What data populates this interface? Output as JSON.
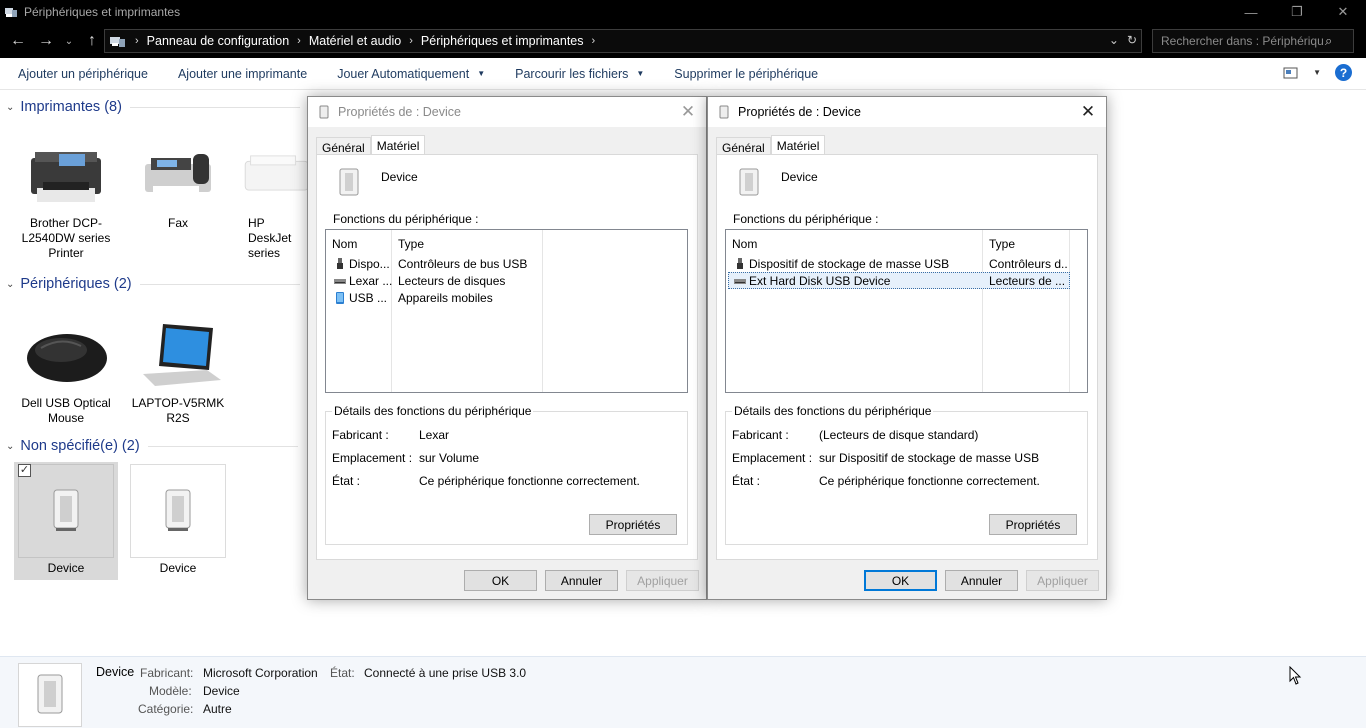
{
  "window": {
    "title": "Périphériques et imprimantes",
    "buttons": [
      "—",
      "❐",
      "✕"
    ]
  },
  "address": {
    "crumbs": [
      "Panneau de configuration",
      "Matériel et audio",
      "Périphériques et imprimantes"
    ],
    "search_placeholder": "Rechercher dans : Périphériqu..."
  },
  "commands": {
    "add_device": "Ajouter un périphérique",
    "add_printer": "Ajouter une imprimante",
    "autoplay": "Jouer Automatiquement",
    "browse_files": "Parcourir les fichiers",
    "remove_device": "Supprimer le périphérique"
  },
  "groups": {
    "printers": "Imprimantes (8)",
    "peripherals": "Périphériques (2)",
    "unspecified": "Non spécifié(e) (2)"
  },
  "devices": {
    "printer1": "Brother DCP-L2540DW series Printer",
    "printer2": "Fax",
    "printer3": "HP DeskJet series",
    "periph1": "Dell USB Optical Mouse",
    "periph2": "LAPTOP-V5RMK R2S",
    "unspec1": "Device",
    "unspec2": "Device"
  },
  "dialog1": {
    "title": "Propriétés de : Device",
    "tab_general": "Général",
    "tab_hardware": "Matériel",
    "device_name": "Device",
    "functions_label": "Fonctions du périphérique :",
    "col_name": "Nom",
    "col_type": "Type",
    "rows": [
      {
        "name": "Dispo...",
        "type": "Contrôleurs de bus USB",
        "icon": "usb-plug-icon"
      },
      {
        "name": "Lexar ...",
        "type": "Lecteurs de disques",
        "icon": "disk-drive-icon"
      },
      {
        "name": "USB ...",
        "type": "Appareils mobiles",
        "icon": "mobile-device-icon"
      }
    ],
    "details_legend": "Détails des fonctions du périphérique",
    "manufacturer_label": "Fabricant :",
    "manufacturer": "Lexar",
    "location_label": "Emplacement :",
    "location": "sur Volume",
    "status_label": "État :",
    "status": "Ce périphérique fonctionne correctement.",
    "properties_btn": "Propriétés",
    "ok": "OK",
    "cancel": "Annuler",
    "apply": "Appliquer"
  },
  "dialog2": {
    "title": "Propriétés de : Device",
    "tab_general": "Général",
    "tab_hardware": "Matériel",
    "device_name": "Device",
    "functions_label": "Fonctions du périphérique :",
    "col_name": "Nom",
    "col_type": "Type",
    "rows": [
      {
        "name": "Dispositif de stockage de masse USB",
        "type": "Contrôleurs d...",
        "icon": "usb-plug-icon"
      },
      {
        "name": "Ext Hard  Disk USB Device",
        "type": "Lecteurs de ...",
        "icon": "disk-drive-icon"
      }
    ],
    "details_legend": "Détails des fonctions du périphérique",
    "manufacturer_label": "Fabricant :",
    "manufacturer": "(Lecteurs de disque standard)",
    "location_label": "Emplacement :",
    "location": "sur Dispositif de stockage de masse USB",
    "status_label": "État :",
    "status": "Ce périphérique fonctionne correctement.",
    "properties_btn": "Propriétés",
    "ok": "OK",
    "cancel": "Annuler",
    "apply": "Appliquer"
  },
  "detailpane": {
    "name": "Device",
    "manufacturer_label": "Fabricant:",
    "manufacturer": "Microsoft Corporation",
    "state_label": "État:",
    "state": "Connecté à une prise USB 3.0",
    "model_label": "Modèle:",
    "model": "Device",
    "category_label": "Catégorie:",
    "category": "Autre"
  },
  "colors": {
    "group_header": "#1e3a8a",
    "accent": "#0078d7",
    "help": "#1a6dd1"
  }
}
